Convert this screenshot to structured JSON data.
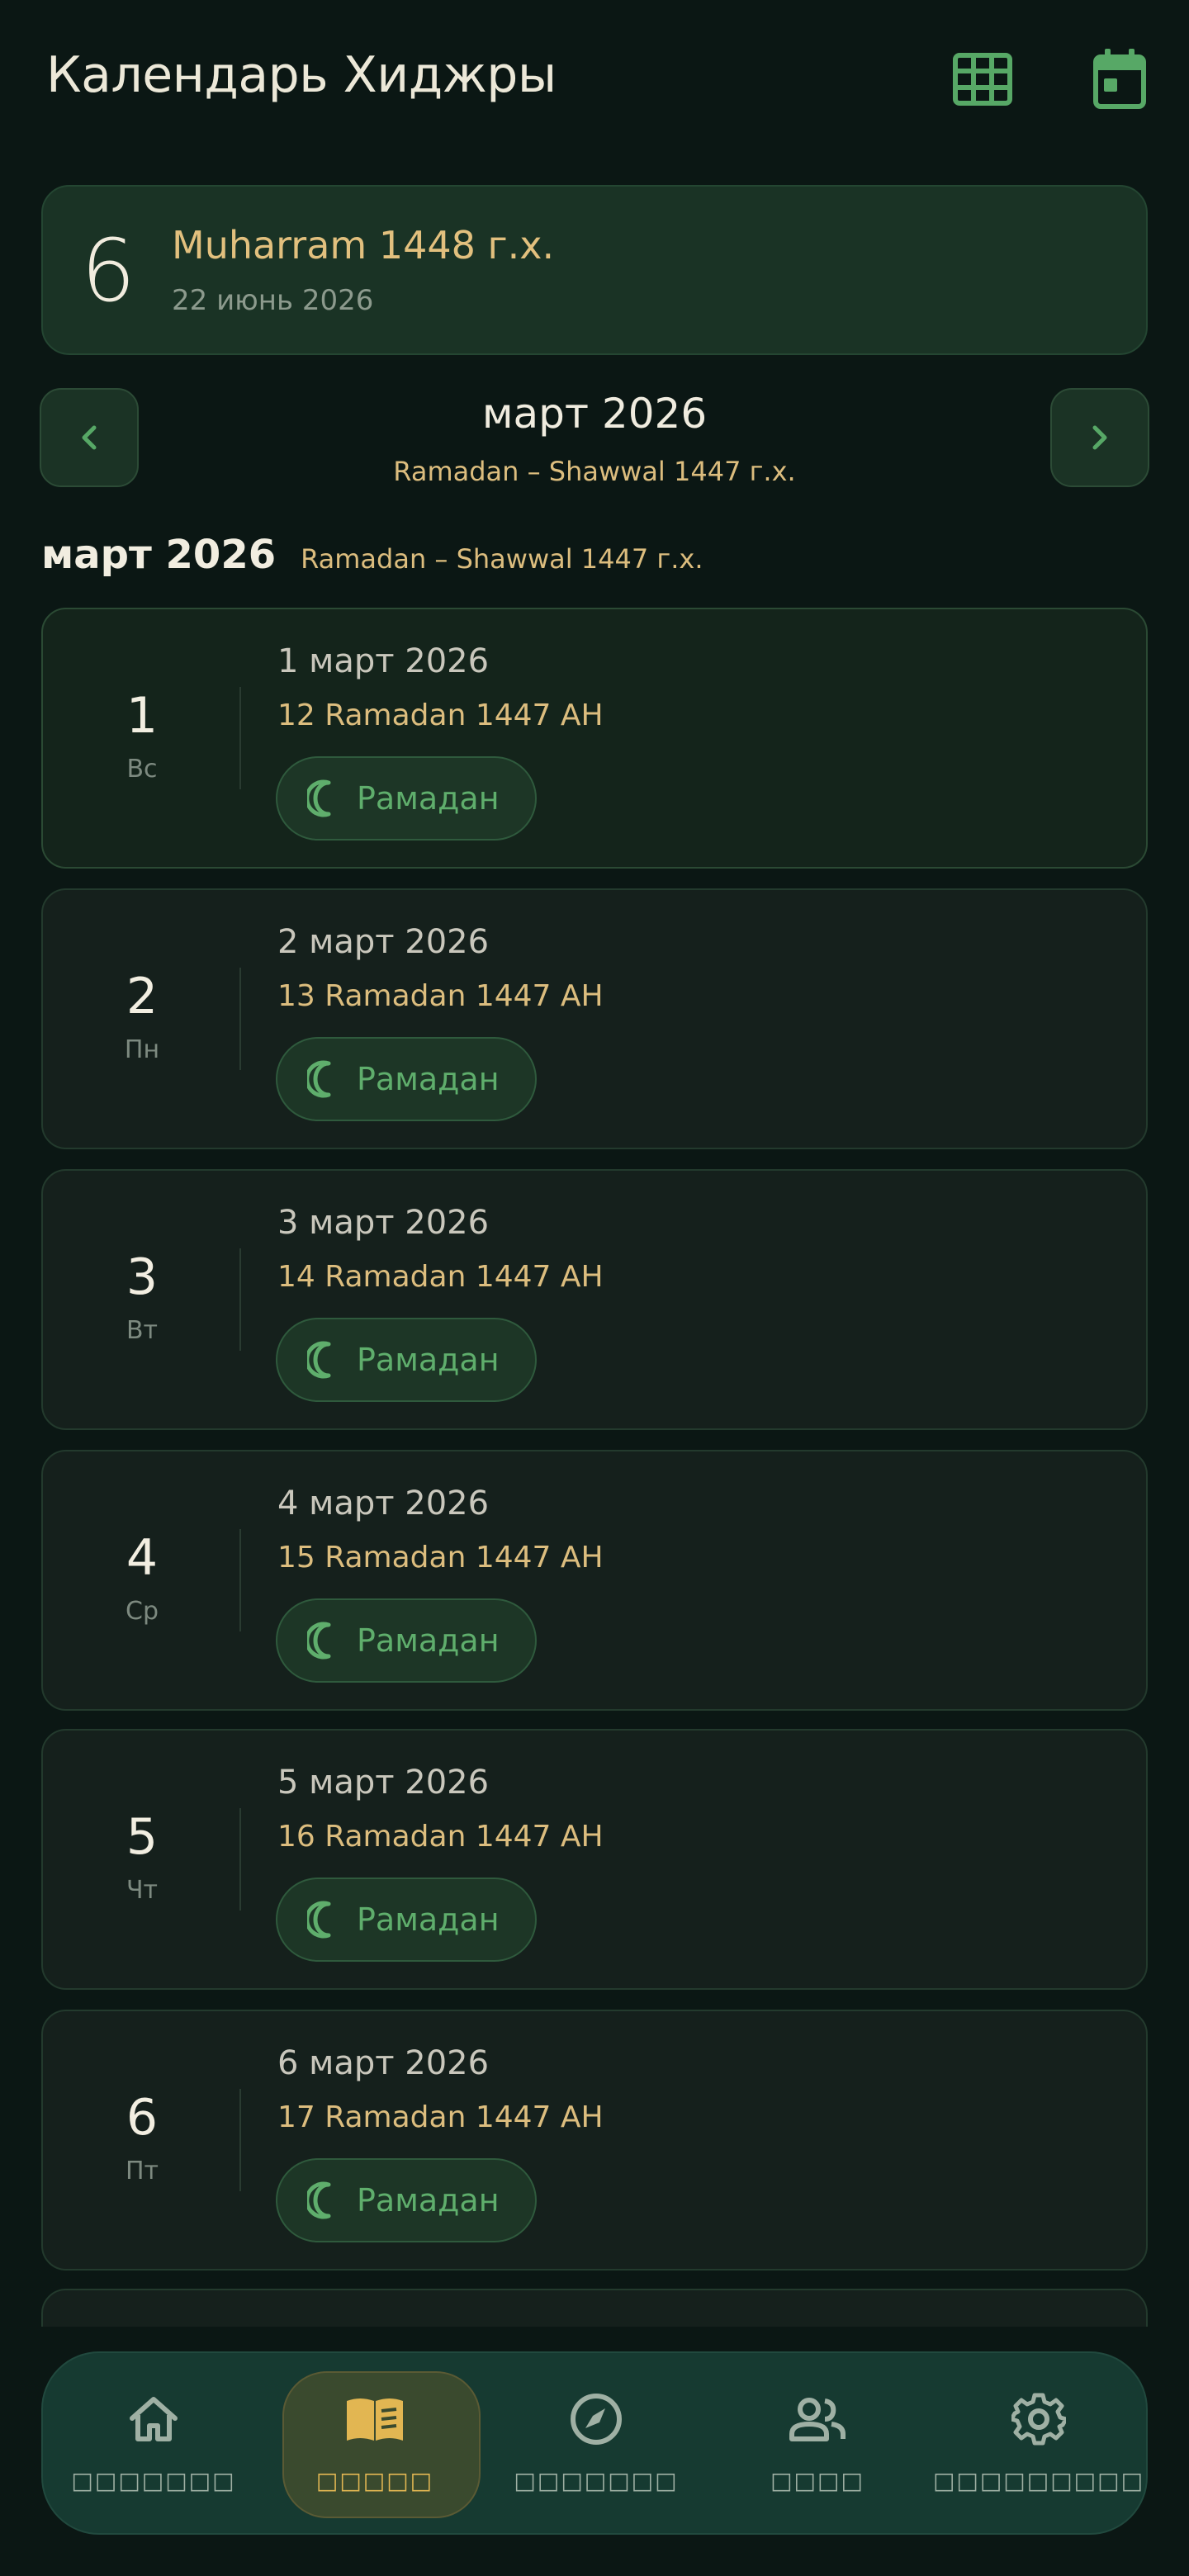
{
  "app": {
    "title": "Календарь Хиджры"
  },
  "header_icons": {
    "grid": "grid-view-icon",
    "calendar": "calendar-today-icon"
  },
  "today": {
    "day": "6",
    "hijri": "Muharram 1448 г.х.",
    "gregorian": "22 июнь 2026"
  },
  "month_nav": {
    "title": "март 2026",
    "subtitle": "Ramadan – Shawwal 1447 г.х."
  },
  "section": {
    "title": "март 2026",
    "subtitle": "Ramadan – Shawwal 1447 г.х."
  },
  "days": [
    {
      "num": "1",
      "dow": "Вс",
      "greg": "1 март 2026",
      "hijri": "12 Ramadan 1447 AH",
      "chip": "Рамадан"
    },
    {
      "num": "2",
      "dow": "Пн",
      "greg": "2 март 2026",
      "hijri": "13 Ramadan 1447 AH",
      "chip": "Рамадан"
    },
    {
      "num": "3",
      "dow": "Вт",
      "greg": "3 март 2026",
      "hijri": "14 Ramadan 1447 AH",
      "chip": "Рамадан"
    },
    {
      "num": "4",
      "dow": "Ср",
      "greg": "4 март 2026",
      "hijri": "15 Ramadan 1447 AH",
      "chip": "Рамадан"
    },
    {
      "num": "5",
      "dow": "Чт",
      "greg": "5 март 2026",
      "hijri": "16 Ramadan 1447 AH",
      "chip": "Рамадан"
    },
    {
      "num": "6",
      "dow": "Пт",
      "greg": "6 март 2026",
      "hijri": "17 Ramadan 1447 AH",
      "chip": "Рамадан"
    }
  ],
  "bottom_nav": [
    {
      "icon": "home-icon",
      "label": "□□□□□□□"
    },
    {
      "icon": "book-icon",
      "label": "□□□□□",
      "active": true
    },
    {
      "icon": "compass-icon",
      "label": "□□□□□□□"
    },
    {
      "icon": "people-icon",
      "label": "□□□□"
    },
    {
      "icon": "settings-icon",
      "label": "□□□□□□□□□"
    }
  ],
  "colors": {
    "background": "#0b1714",
    "gold": "#dcbd7e",
    "green": "#5fae6c",
    "active_nav": "#e2b652"
  }
}
